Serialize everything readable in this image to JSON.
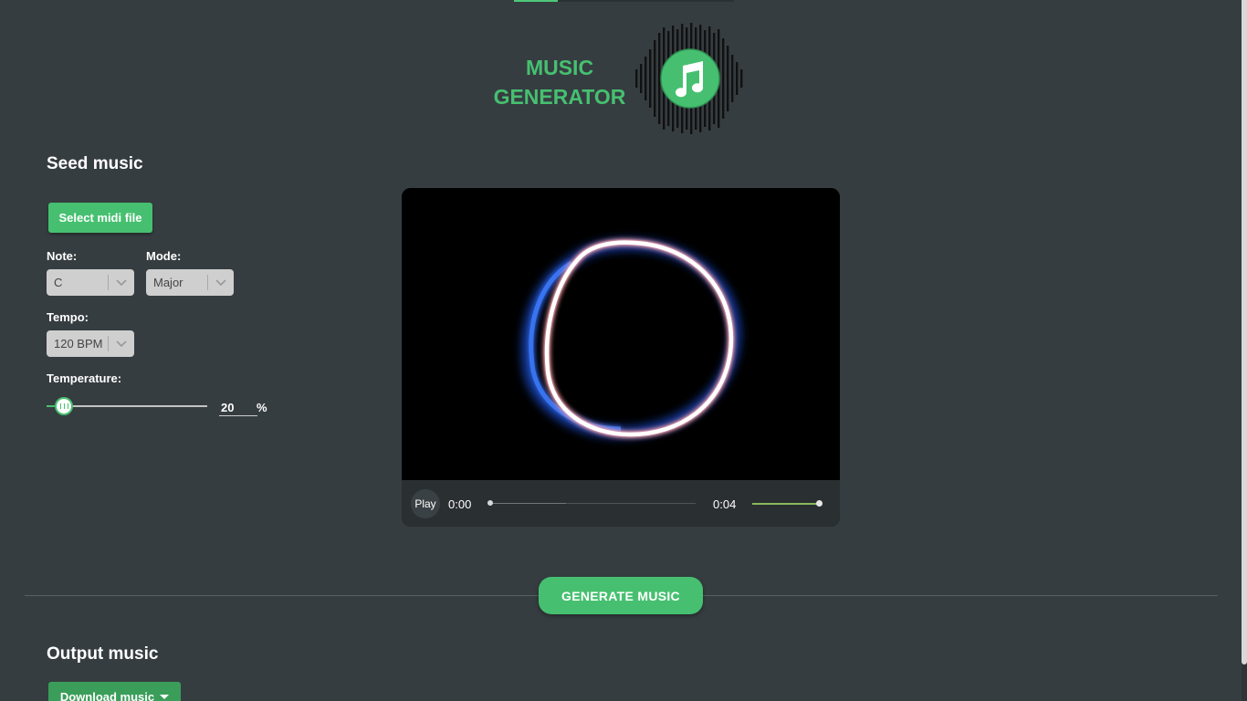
{
  "logo": {
    "line1": "MUSIC",
    "line2": "GENERATOR",
    "icon": "music-note-icon",
    "color": "#46c070"
  },
  "seed": {
    "title": "Seed music",
    "select_midi_label": "Select midi file",
    "note": {
      "label": "Note:",
      "value": "C"
    },
    "mode": {
      "label": "Mode:",
      "value": "Major"
    },
    "tempo": {
      "label": "Tempo:",
      "value": "120 BPM"
    },
    "temperature": {
      "label": "Temperature:",
      "value": "20",
      "unit": "%",
      "level_percent": 20
    }
  },
  "player": {
    "play_label": "Play",
    "current_time": "0:00",
    "duration": "0:04",
    "seek_fraction": 0,
    "volume_fraction": 1
  },
  "generate": {
    "label": "GENERATE MUSIC"
  },
  "output": {
    "title": "Output music",
    "download_label": "Download music"
  },
  "colors": {
    "accent": "#46c070",
    "background": "#363d41"
  }
}
